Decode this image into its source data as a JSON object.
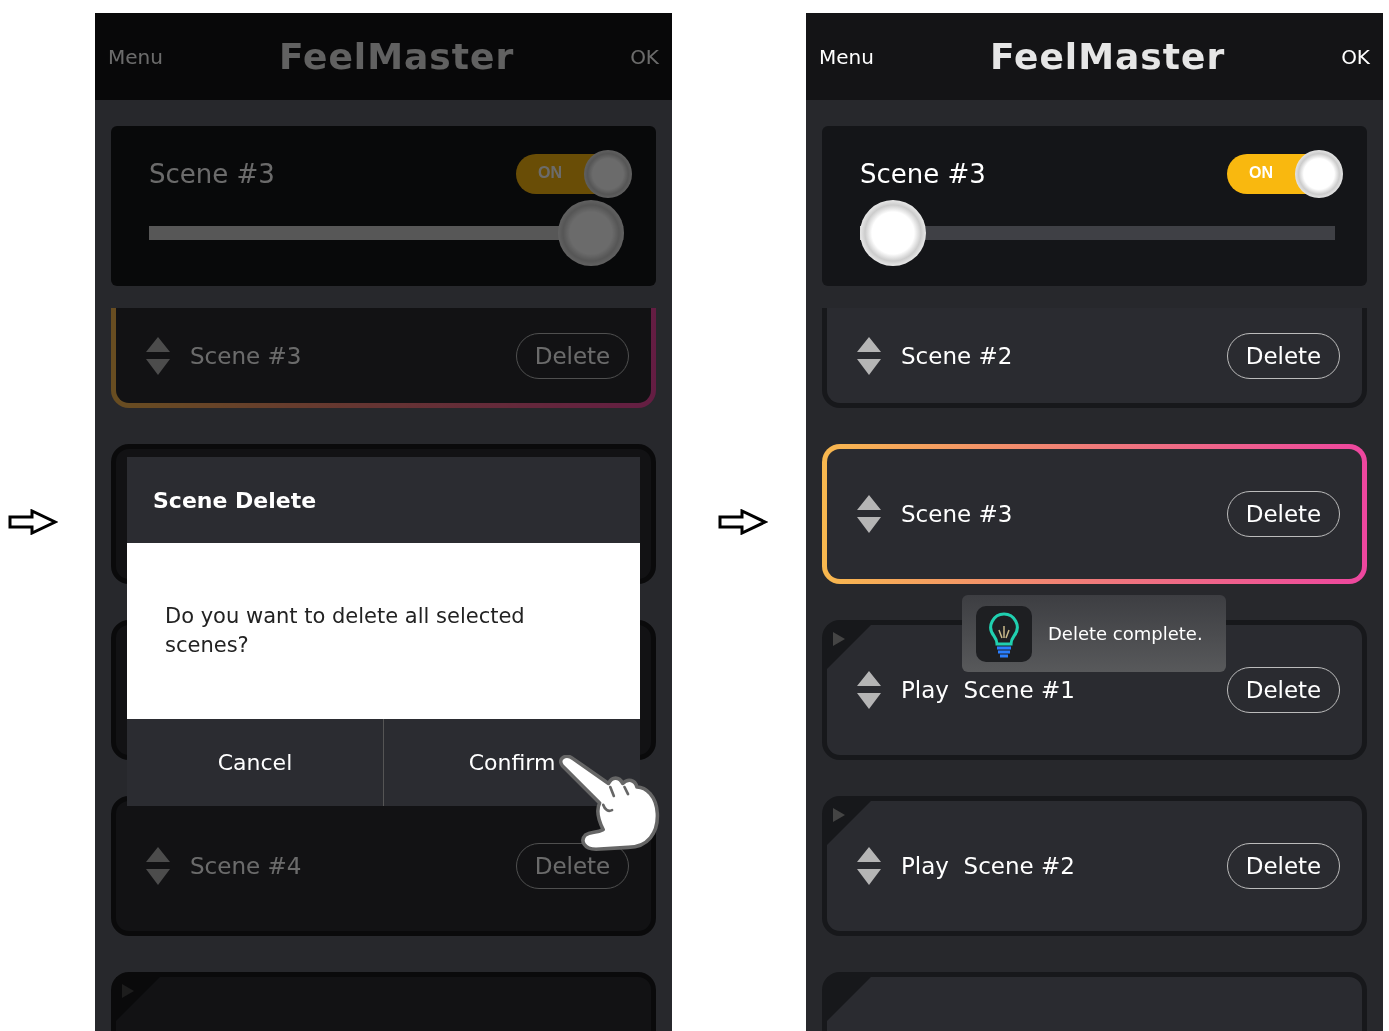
{
  "screens": [
    {
      "header": {
        "menu": "Menu",
        "title": "FeelMaster",
        "ok": "OK"
      },
      "dimmed": true,
      "scene": {
        "title": "Scene #3",
        "toggle": {
          "label": "ON",
          "on": true
        },
        "level": 1
      },
      "rows": [
        {
          "kind": "scene",
          "label": "Scene #3",
          "delete": "Delete",
          "selected": true
        },
        {
          "kind": "blank",
          "selected": false
        },
        {
          "kind": "blank",
          "selected": false
        },
        {
          "kind": "scene",
          "label": "Scene #4",
          "delete": "Delete",
          "selected": false
        },
        {
          "kind": "play",
          "selected": false
        }
      ],
      "dialog": {
        "title": "Scene Delete",
        "message": "Do you want to delete all selected scenes?",
        "buttons": [
          "Cancel",
          "Confirm"
        ]
      }
    },
    {
      "header": {
        "menu": "Menu",
        "title": "FeelMaster",
        "ok": "OK"
      },
      "dimmed": false,
      "scene": {
        "title": "Scene #3",
        "toggle": {
          "label": "ON",
          "on": true
        },
        "level": 0
      },
      "rows": [
        {
          "kind": "scene",
          "label": "Scene #2",
          "delete": "Delete",
          "selected": false
        },
        {
          "kind": "scene",
          "label": "Scene #3",
          "delete": "Delete",
          "selected": true
        },
        {
          "kind": "play",
          "label": "Play  Scene #1",
          "delete": "Delete",
          "selected": false
        },
        {
          "kind": "play",
          "label": "Play  Scene #2",
          "delete": "Delete",
          "selected": false
        },
        {
          "kind": "corner",
          "selected": false
        }
      ],
      "toast": {
        "text": "Delete complete."
      }
    }
  ]
}
